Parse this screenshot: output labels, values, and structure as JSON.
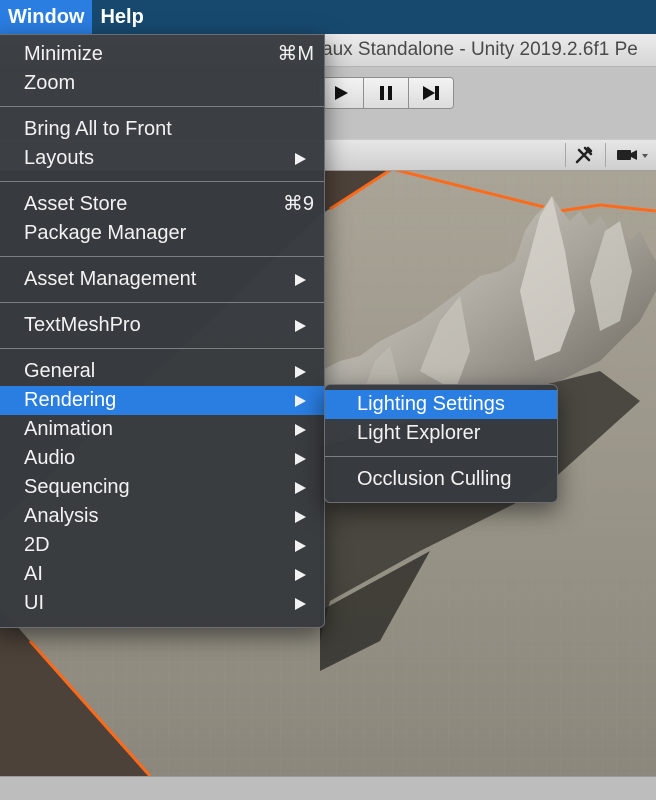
{
  "menubar": {
    "items": [
      {
        "label": "Window"
      },
      {
        "label": "Help"
      }
    ]
  },
  "unity": {
    "title": "aux Standalone - Unity 2019.2.6f1 Pe"
  },
  "window_menu": {
    "groups": [
      [
        {
          "label": "Minimize",
          "shortcut": "⌘M"
        },
        {
          "label": "Zoom"
        }
      ],
      [
        {
          "label": "Bring All to Front"
        },
        {
          "label": "Layouts",
          "submenu": true
        }
      ],
      [
        {
          "label": "Asset Store",
          "shortcut": "⌘9"
        },
        {
          "label": "Package Manager"
        }
      ],
      [
        {
          "label": "Asset Management",
          "submenu": true
        }
      ],
      [
        {
          "label": "TextMeshPro",
          "submenu": true
        }
      ],
      [
        {
          "label": "General",
          "submenu": true
        },
        {
          "label": "Rendering",
          "submenu": true,
          "highlighted": true
        },
        {
          "label": "Animation",
          "submenu": true
        },
        {
          "label": "Audio",
          "submenu": true
        },
        {
          "label": "Sequencing",
          "submenu": true
        },
        {
          "label": "Analysis",
          "submenu": true
        },
        {
          "label": "2D",
          "submenu": true
        },
        {
          "label": "AI",
          "submenu": true
        },
        {
          "label": "UI",
          "submenu": true
        }
      ]
    ]
  },
  "rendering_submenu": {
    "groups": [
      [
        {
          "label": "Lighting Settings",
          "highlighted": true
        },
        {
          "label": "Light Explorer"
        }
      ],
      [
        {
          "label": "Occlusion Culling"
        }
      ]
    ]
  },
  "colors": {
    "menubar": "#17496f",
    "highlight": "#2a7de1",
    "menu_bg": "#373a3e",
    "terrain_outline": "#ff6a1a"
  }
}
